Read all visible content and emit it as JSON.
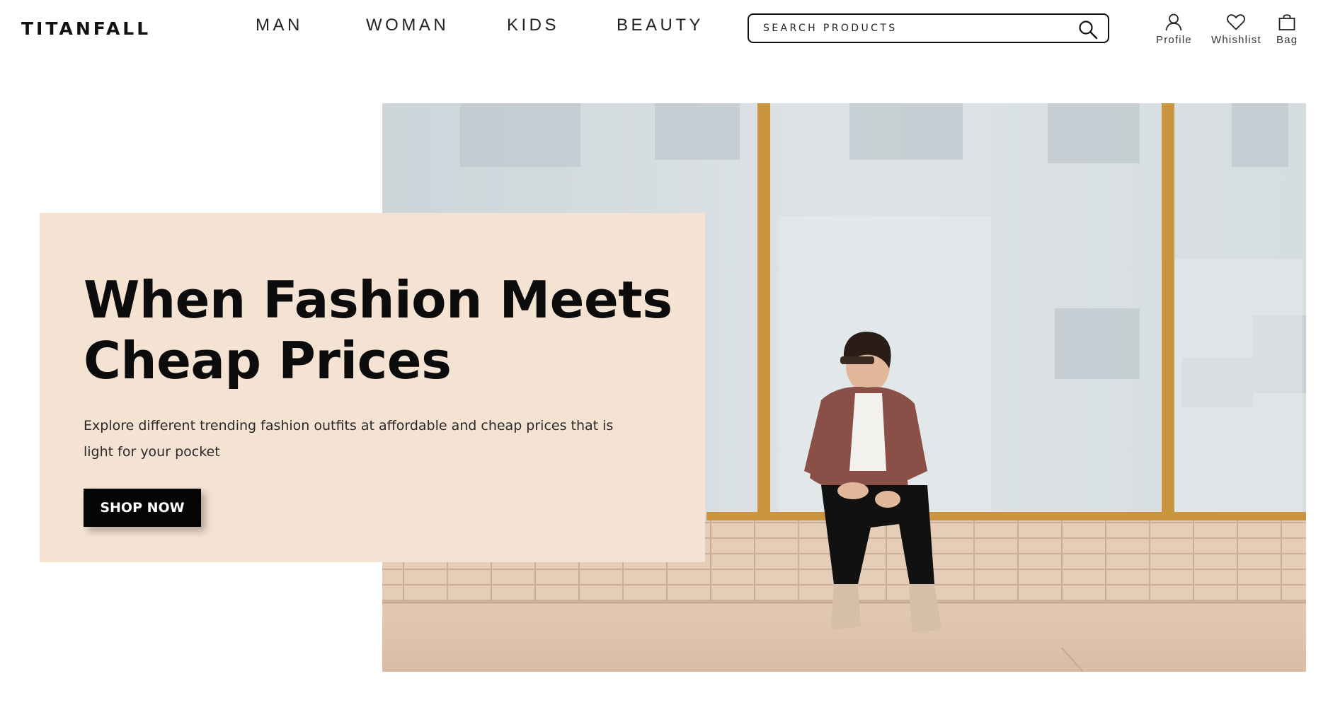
{
  "header": {
    "logo": "TITANFALL",
    "nav": [
      {
        "label": "MAN"
      },
      {
        "label": "WOMAN"
      },
      {
        "label": "KIDS"
      },
      {
        "label": "BEAUTY"
      }
    ],
    "search": {
      "placeholder": "SEARCH PRODUCTS",
      "icon": "search-icon"
    },
    "actions": [
      {
        "label": "Profile",
        "icon": "user-icon"
      },
      {
        "label": "Whishlist",
        "icon": "heart-icon"
      },
      {
        "label": "Bag",
        "icon": "shopping-bag-icon"
      }
    ]
  },
  "hero": {
    "title_line1": "When Fashion Meets",
    "title_line2": "Cheap Prices",
    "description": "Explore different trending fashion outfits at affordable and cheap prices that is light for your pocket",
    "button_label": "SHOP NOW"
  },
  "colors": {
    "card_background": "#f4e2d3",
    "button_background": "#050505",
    "button_text": "#ffffff",
    "text_primary": "#111111"
  }
}
